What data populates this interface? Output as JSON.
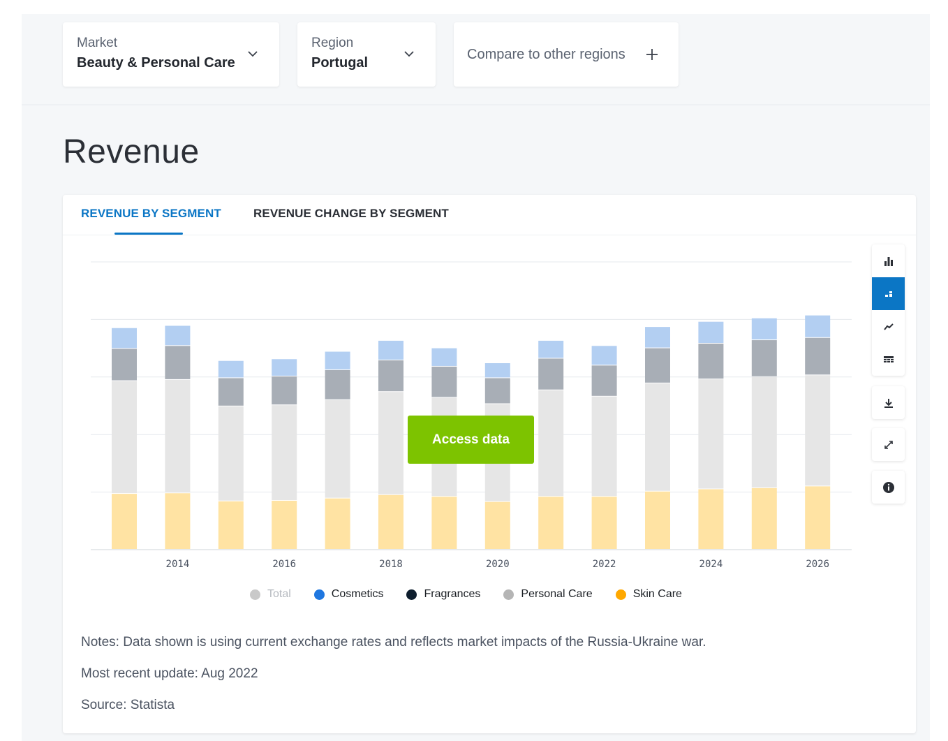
{
  "filters": {
    "market": {
      "label": "Market",
      "value": "Beauty & Personal Care",
      "icon": "chevron-down-icon"
    },
    "region": {
      "label": "Region",
      "value": "Portugal",
      "icon": "chevron-down-icon"
    },
    "compare": {
      "label": "Compare to other regions",
      "icon": "plus-icon"
    }
  },
  "section_title": "Revenue",
  "tabs": [
    {
      "label": "REVENUE BY SEGMENT",
      "active": true
    },
    {
      "label": "REVENUE CHANGE BY SEGMENT",
      "active": false
    }
  ],
  "access_button": "Access data",
  "toolbar": {
    "view_buttons": [
      {
        "icon": "bar-chart-icon",
        "active": false
      },
      {
        "icon": "stacked-bar-chart-icon",
        "active": true
      },
      {
        "icon": "line-chart-icon",
        "active": false
      },
      {
        "icon": "table-icon",
        "active": false
      }
    ],
    "download": {
      "icon": "download-icon"
    },
    "fullscreen": {
      "icon": "expand-icon"
    },
    "info": {
      "icon": "info-icon"
    }
  },
  "notes": {
    "notes": "Notes: Data shown is using current exchange rates and reflects market impacts of the Russia-Ukraine war.",
    "update": "Most recent update: Aug 2022",
    "source": "Source: Statista"
  },
  "colors": {
    "accent": "#0b76c5",
    "access_button": "#7dc300",
    "cosmetics_bar": "#b3cff2",
    "personal_care_bar": "#a8aeb6",
    "fragrances_bar": "#e6e6e6",
    "skin_care_bar": "#ffe3a3"
  },
  "chart_data": {
    "type": "bar",
    "stacked": true,
    "x": [
      2013,
      2014,
      2015,
      2016,
      2017,
      2018,
      2019,
      2020,
      2021,
      2022,
      2023,
      2024,
      2025,
      2026
    ],
    "x_tick_labels": [
      "2014",
      "2016",
      "2018",
      "2020",
      "2022",
      "2024",
      "2026"
    ],
    "ylim": [
      0,
      5
    ],
    "grid": true,
    "legend_position": "bottom",
    "legend": [
      {
        "name": "Total",
        "color": "#c9c9c9",
        "muted": true
      },
      {
        "name": "Cosmetics",
        "color": "#1f77e0",
        "muted": false
      },
      {
        "name": "Fragrances",
        "color": "#0e1e2e",
        "muted": false
      },
      {
        "name": "Personal Care",
        "color": "#b5b5b5",
        "muted": false
      },
      {
        "name": "Skin Care",
        "color": "#ffa800",
        "muted": false
      }
    ],
    "series": [
      {
        "name": "Skin Care",
        "color": "#ffe3a3",
        "values": [
          0.97,
          0.98,
          0.84,
          0.85,
          0.89,
          0.95,
          0.92,
          0.83,
          0.92,
          0.92,
          1.01,
          1.05,
          1.07,
          1.1
        ]
      },
      {
        "name": "Fragrances",
        "color": "#e6e6e6",
        "values": [
          1.96,
          1.97,
          1.65,
          1.66,
          1.71,
          1.79,
          1.72,
          1.7,
          1.85,
          1.74,
          1.88,
          1.91,
          1.93,
          1.93
        ]
      },
      {
        "name": "Personal Care",
        "color": "#a8aeb6",
        "values": [
          0.56,
          0.59,
          0.49,
          0.5,
          0.52,
          0.55,
          0.54,
          0.45,
          0.55,
          0.54,
          0.61,
          0.62,
          0.64,
          0.65
        ]
      },
      {
        "name": "Cosmetics",
        "color": "#b3cff2",
        "values": [
          0.36,
          0.35,
          0.3,
          0.3,
          0.32,
          0.34,
          0.32,
          0.26,
          0.31,
          0.34,
          0.37,
          0.38,
          0.38,
          0.39
        ]
      }
    ]
  }
}
